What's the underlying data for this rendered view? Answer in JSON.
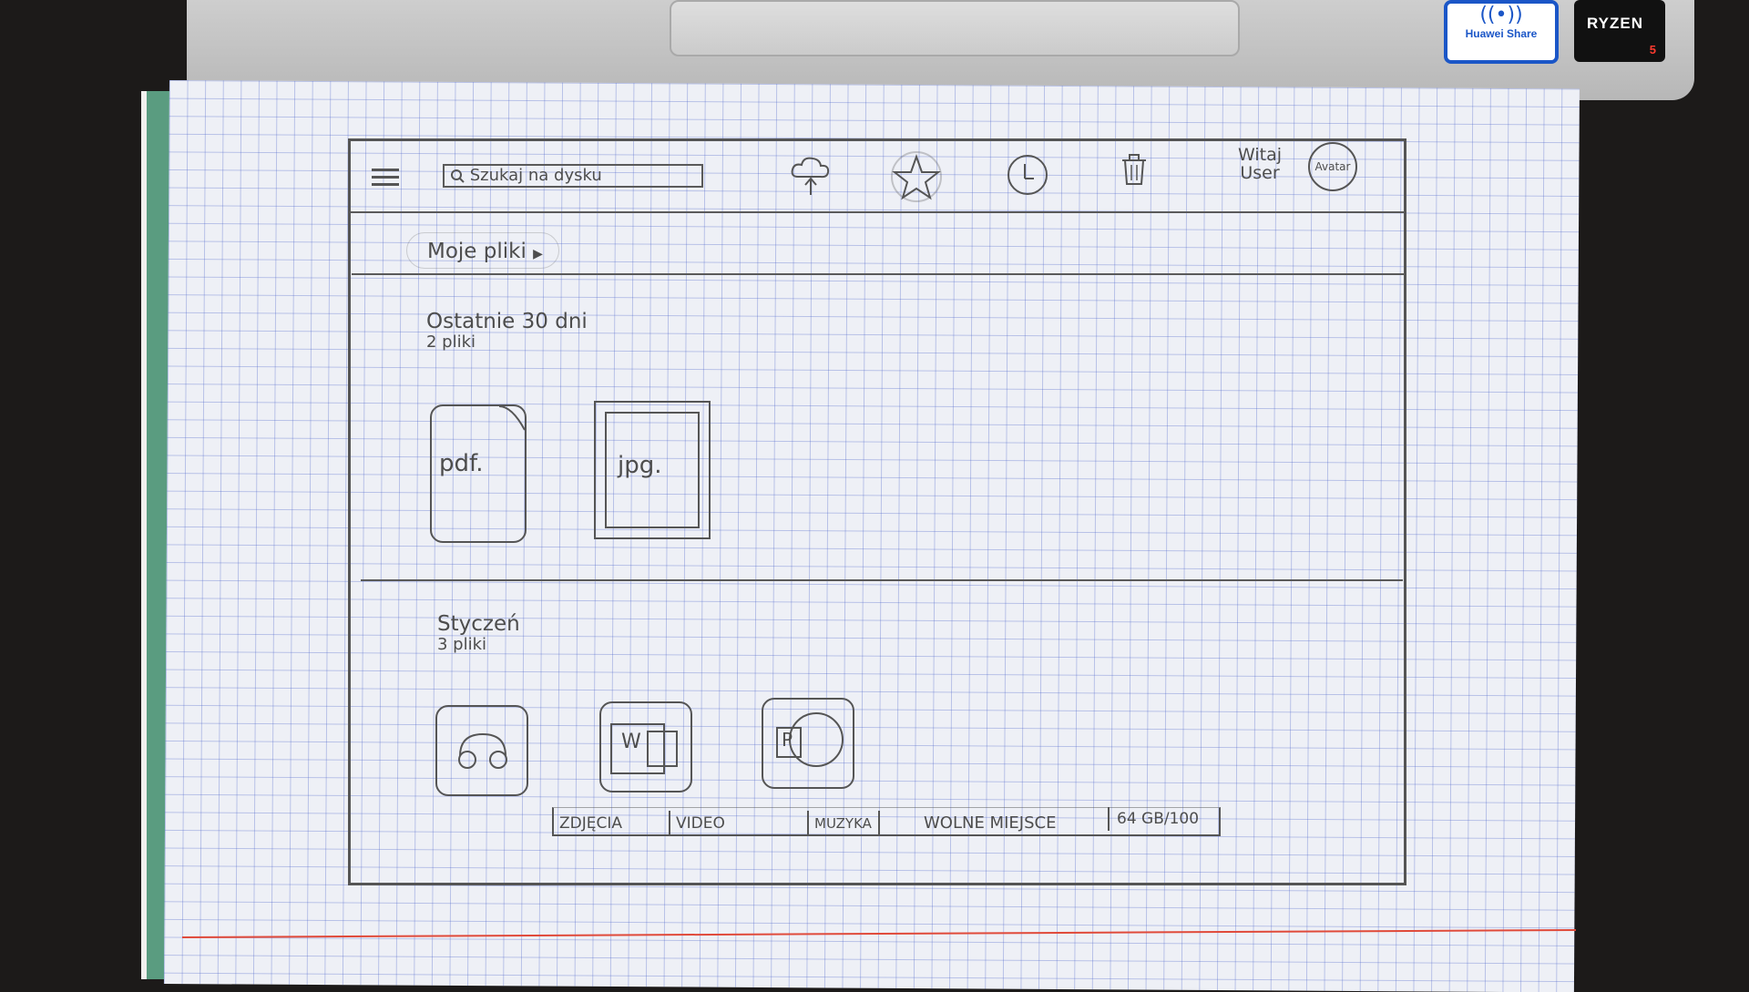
{
  "stickers": {
    "huawei_label": "Huawei Share",
    "ryzen_label": "RYZEN",
    "ryzen_number": "5"
  },
  "header": {
    "search_placeholder": "Szukaj na dysku",
    "greeting_line1": "Witaj",
    "greeting_line2": "User",
    "avatar_label": "Avatar"
  },
  "breadcrumb": {
    "label": "Moje pliki"
  },
  "sections": [
    {
      "title": "Ostatnie 30 dni",
      "count": "2 pliki",
      "files": [
        {
          "label": "pdf.",
          "icon": "pdf-file-icon"
        },
        {
          "label": "jpg.",
          "icon": "image-file-icon"
        }
      ]
    },
    {
      "title": "Styczeń",
      "count": "3 pliki",
      "files": [
        {
          "label": "",
          "icon": "audio-app-icon"
        },
        {
          "label": "W",
          "icon": "word-app-icon"
        },
        {
          "label": "P",
          "icon": "powerpoint-app-icon"
        }
      ]
    }
  ],
  "bottom_bar": {
    "tabs": [
      "ZDJĘCIA",
      "VIDEO",
      "MUZYKA"
    ],
    "storage_label": "WOLNE MIEJSCE",
    "storage_value": "64 GB/100",
    "storage_used_gb": 64,
    "storage_total_gb": 100
  },
  "colors": {
    "pencil": "#4d4d4d",
    "grid": "#465fc8",
    "paper": "#eef0f6",
    "margin_line": "#e04a3a",
    "notebook_cover": "#5a9c80"
  }
}
